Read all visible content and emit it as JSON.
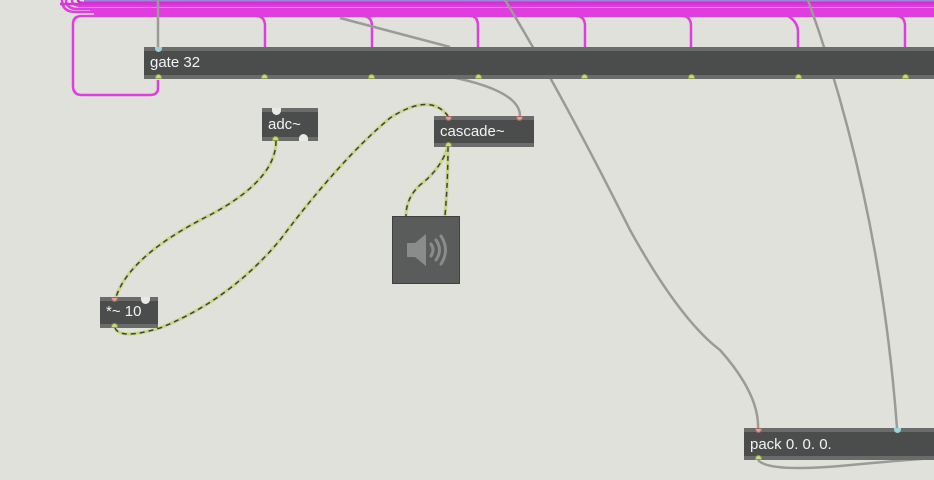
{
  "objects": {
    "gate": {
      "label": "gate 32"
    },
    "adc": {
      "label": "adc~"
    },
    "cascade": {
      "label": "cascade~"
    },
    "mult": {
      "label": "*~ 10"
    },
    "pack": {
      "label": "pack 0. 0. 0."
    }
  },
  "dac": {
    "icon": "speaker-icon"
  },
  "colors": {
    "background": "#e1e1dc",
    "object": "#4b4d4c",
    "object_text": "#f2f2f2",
    "control_patchcord": "#9a9a98",
    "signal_patchcord": "#c9d78a",
    "multichannel_patchcord": "#e13ce0"
  }
}
